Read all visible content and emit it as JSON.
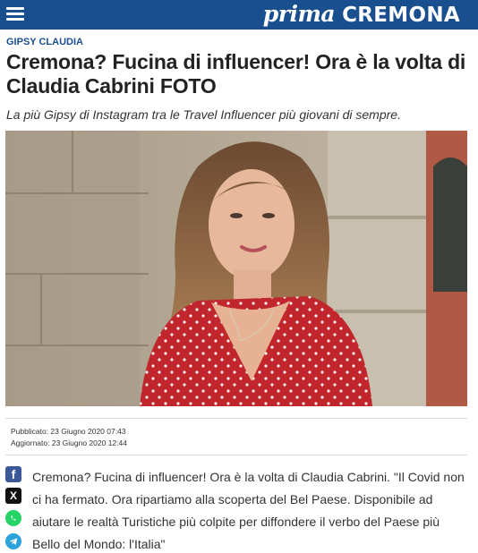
{
  "header": {
    "logo_prima": "prima",
    "logo_city": "CREMONA",
    "menu_icon": "hamburger-menu-icon"
  },
  "article": {
    "category": "GIPSY CLAUDIA",
    "title": "Cremona? Fucina di influencer! Ora è la volta di Claudia Cabrini FOTO",
    "subtitle": "La più Gipsy di Instagram tra le Travel Influencer più giovani di sempre.",
    "published": "Pubblicato: 23 Giugno 2020 07:43",
    "updated": "Aggiornato: 23 Giugno 2020 12:44",
    "body": "Cremona? Fucina di influencer! Ora è la volta di Claudia Cabrini. \"Il Covid non ci ha fermato. Ora ripartiamo alla scoperta del Bel Paese. Disponibile ad aiutare le realtà Turistiche più colpite per diffondere il verbo del Paese più Bello del Mondo: l'Italia\""
  },
  "share": {
    "icons": [
      "facebook-icon",
      "x-icon",
      "whatsapp-icon",
      "telegram-icon"
    ],
    "facebook_glyph": "f",
    "x_glyph": "X"
  },
  "colors": {
    "brand_blue": "#1a4f8f",
    "dress_red": "#c0262b",
    "facebook": "#3b5998",
    "whatsapp": "#25d366",
    "telegram": "#2aa3dc"
  }
}
